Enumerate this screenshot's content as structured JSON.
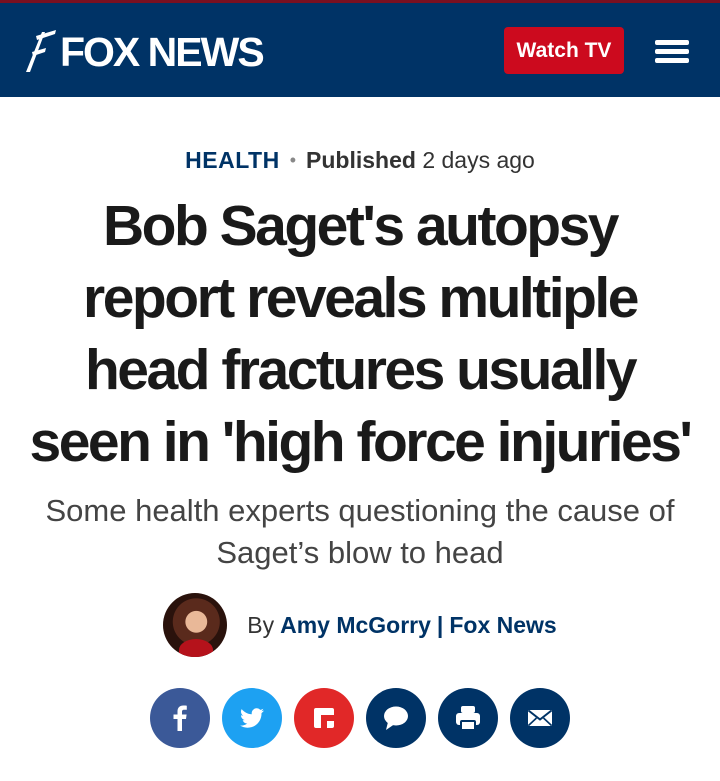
{
  "header": {
    "logo_text": "FOX NEWS",
    "watch_label": "Watch TV",
    "menu_icon": "hamburger-menu-icon"
  },
  "article": {
    "category": "HEALTH",
    "published_label": "Published",
    "published_time": "2 days ago",
    "headline_lines": [
      "Bob Saget's autopsy",
      "report reveals multiple",
      "head fractures usually",
      "seen in 'high force injuries'"
    ],
    "subhead": "Some health experts questioning the cause of Saget’s blow to head",
    "byline": {
      "by": "By",
      "author": "Amy McGorry",
      "separator": "|",
      "outlet": "Fox News"
    }
  },
  "share": {
    "icons": [
      "facebook-icon",
      "twitter-icon",
      "flipboard-icon",
      "comment-icon",
      "print-icon",
      "email-icon"
    ],
    "colors": {
      "facebook": "#3b5998",
      "twitter": "#1da1f2",
      "flipboard": "#e12828",
      "navy": "#003366"
    }
  },
  "colors": {
    "brand_navy": "#003366",
    "watch_red": "#cc0a1e"
  }
}
